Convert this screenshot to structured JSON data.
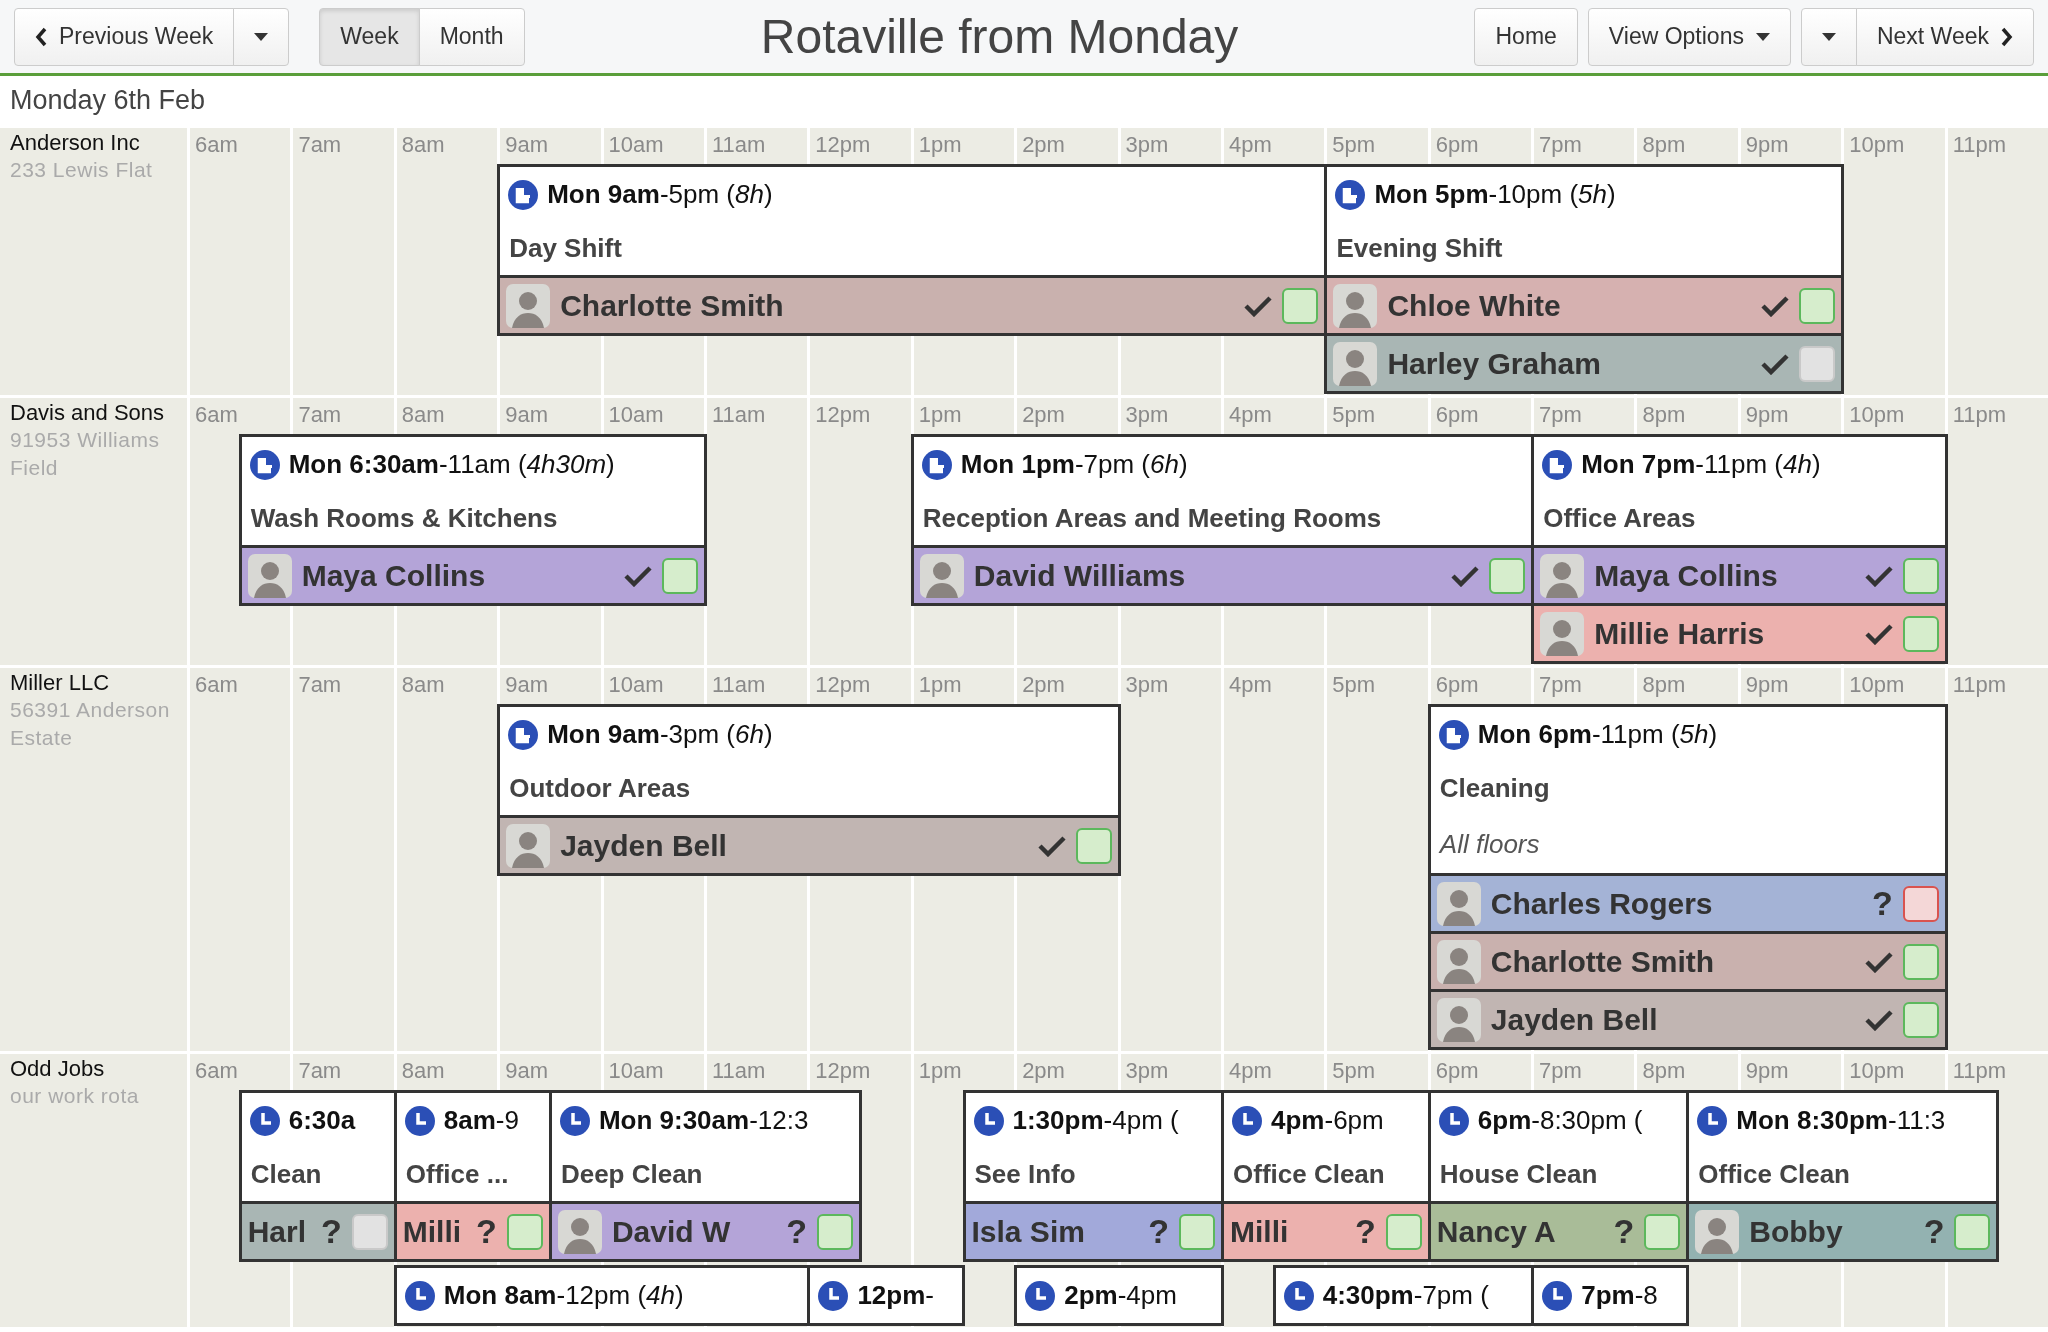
{
  "header": {
    "prev_button": "Previous Week",
    "views": [
      {
        "label": "Week",
        "selected": true
      },
      {
        "label": "Month",
        "selected": false
      }
    ],
    "title": "Rotaville from Monday",
    "home_button": "Home",
    "options_button": "View Options",
    "next_button": "Next Week"
  },
  "date": "Monday 6th Feb",
  "rows": [
    {
      "name": "Anderson Inc",
      "address": "233 Lewis Flat",
      "hours": [
        "6am",
        "7am",
        "8am",
        "9am",
        "10am",
        "11am",
        "12pm",
        "1pm",
        "2pm",
        "3pm",
        "4pm",
        "5pm",
        "6pm",
        "7pm",
        "8pm",
        "9pm",
        "10pm",
        "11pm"
      ],
      "shifts": [
        {
          "recurring": true,
          "time": "**Mon 9am**-5pm (*8h*)",
          "title": "Day Shift",
          "staff": [
            {
              "name": "Charlotte Smith",
              "avatar": true,
              "color": "#c9b1ae",
              "confirmed": true,
              "box": {
                "color": "#d6edcc"
              }
            }
          ]
        },
        {
          "recurring": true,
          "time": "**Mon 5pm**-10pm (*5h*)",
          "title": "Evening Shift",
          "staff": [
            {
              "name": "Chloe White",
              "avatar": true,
              "color": "#d6b1b0",
              "confirmed": true,
              "box": {
                "color": "#d6edcc"
              }
            },
            {
              "name": "Harley Graham",
              "avatar": true,
              "color": "#a9b6b4",
              "confirmed": true,
              "box": {
                "color": "#e2e2e2"
              }
            }
          ]
        }
      ]
    },
    {
      "name": "Davis and Sons",
      "address": "91953 Williams Field",
      "hours": [
        "6am",
        "7am",
        "8am",
        "9am",
        "10am",
        "11am",
        "12pm",
        "1pm",
        "2pm",
        "3pm",
        "4pm",
        "5pm",
        "6pm",
        "7pm",
        "8pm",
        "9pm",
        "10pm",
        "11pm"
      ],
      "shifts": [
        {
          "recurring": true,
          "time": "**Mon 6:30am**-11am (*4h30m*)",
          "title": "Wash Rooms & Kitchens",
          "staff": [
            {
              "name": "Maya Collins",
              "avatar": true,
              "color": "#b4a4d8",
              "confirmed": true,
              "box": {
                "color": "#d6edcc"
              }
            }
          ]
        },
        {
          "recurring": true,
          "time": "**Mon 1pm**-7pm (*6h*)",
          "title": "Reception Areas and Meeting Rooms",
          "staff": [
            {
              "name": "David Williams",
              "avatar": true,
              "color": "#b4a4d8",
              "confirmed": true,
              "box": {
                "color": "#d6edcc"
              }
            }
          ]
        },
        {
          "recurring": true,
          "time": "**Mon 7pm**-11pm (*4h*)",
          "title": "Office Areas",
          "staff": [
            {
              "name": "Maya Collins",
              "avatar": true,
              "color": "#b4a4d8",
              "confirmed": true,
              "box": {
                "color": "#d6edcc"
              }
            },
            {
              "name": "Millie Harris",
              "avatar": true,
              "color": "#ecb1ae",
              "confirmed": true,
              "box": {
                "color": "#d6edcc"
              }
            }
          ]
        }
      ]
    },
    {
      "name": "Miller LLC",
      "address": "56391 Anderson Estate",
      "hours": [
        "6am",
        "7am",
        "8am",
        "9am",
        "10am",
        "11am",
        "12pm",
        "1pm",
        "2pm",
        "3pm",
        "4pm",
        "5pm",
        "6pm",
        "7pm",
        "8pm",
        "9pm",
        "10pm",
        "11pm"
      ],
      "shifts": [
        {
          "recurring": true,
          "time": "**Mon 9am**-3pm (*6h*)",
          "title": "Outdoor Areas",
          "staff": [
            {
              "name": "Jayden Bell",
              "avatar": true,
              "color": "#c1b5b2",
              "confirmed": true,
              "box": {
                "color": "#d6edcc"
              }
            }
          ]
        },
        {
          "recurring": true,
          "time": "**Mon 6pm**-11pm (*5h*)",
          "title": "Cleaning",
          "note": "All floors",
          "staff": [
            {
              "name": "Charles Rogers",
              "avatar": true,
              "color": "#a4b3d6",
              "confirmed": false,
              "answer": "?",
              "box": {
                "color": "#f4d7d7"
              }
            },
            {
              "name": "Charlotte Smith",
              "avatar": true,
              "color": "#c9b1ae",
              "confirmed": true,
              "box": {
                "color": "#d6edcc"
              }
            },
            {
              "name": "Jayden Bell",
              "avatar": true,
              "color": "#c1b5b2",
              "confirmed": true,
              "box": {
                "color": "#d6edcc"
              }
            }
          ]
        }
      ]
    },
    {
      "name": "Odd Jobs",
      "address": "our work rota",
      "hours": [
        "6am",
        "7am",
        "8am",
        "9am",
        "10am",
        "11am",
        "12pm",
        "1pm",
        "2pm",
        "3pm",
        "4pm",
        "5pm",
        "6pm",
        "7pm",
        "8pm",
        "9pm",
        "10pm",
        "11pm"
      ],
      "shifts": [
        {
          "recurring": false,
          "time": "**6:30a**",
          "title": "Clean",
          "staff": [
            {
              "name": "Harl",
              "avatar": false,
              "color": "#a9b6b4",
              "confirmed": false,
              "answer": "?",
              "box": {
                "color": "#e2e2e2"
              }
            }
          ]
        },
        {
          "recurring": false,
          "time": "**8am**-9",
          "title": "Office ...",
          "staff": [
            {
              "name": "Milli",
              "avatar": false,
              "color": "#ecb1ae",
              "confirmed": false,
              "answer": "?",
              "box": {
                "color": "#d6edcc"
              }
            }
          ]
        },
        {
          "recurring": false,
          "time": "**Mon 9:30am**-12:3",
          "title": "Deep Clean",
          "staff": [
            {
              "name": "David W",
              "avatar": true,
              "color": "#b4a4d8",
              "confirmed": false,
              "answer": "?",
              "box": {
                "color": "#d6edcc"
              }
            }
          ]
        },
        {
          "recurring": false,
          "time": "**1:30pm**-4pm (",
          "title": "See Info",
          "staff": [
            {
              "name": "Isla Sim",
              "avatar": false,
              "color": "#a2a9da",
              "confirmed": false,
              "answer": "?",
              "box": {
                "color": "#d6edcc"
              }
            }
          ]
        },
        {
          "recurring": false,
          "time": "**4pm**-6pm",
          "title": "Office Clean",
          "staff": [
            {
              "name": "Milli",
              "avatar": false,
              "color": "#ecb1ae",
              "confirmed": false,
              "answer": "?",
              "box": {
                "color": "#d6edcc"
              }
            }
          ]
        },
        {
          "recurring": false,
          "time": "**6pm**-8:30pm (",
          "title": "House Clean",
          "staff": [
            {
              "name": "Nancy A",
              "avatar": false,
              "color": "#a9bc98",
              "confirmed": false,
              "answer": "?",
              "box": {
                "color": "#d6edcc"
              }
            }
          ]
        },
        {
          "recurring": false,
          "time": "**Mon 8:30pm**-11:3",
          "title": "Office Clean",
          "staff": [
            {
              "name": "Bobby",
              "avatar": true,
              "color": "#93b2b1",
              "confirmed": false,
              "answer": "?",
              "box": {
                "color": "#d6edcc"
              }
            }
          ]
        },
        {
          "recurring": false,
          "time": "**Mon 8am**-12pm (*4h*)"
        },
        {
          "recurring": false,
          "time": "**12pm**-"
        },
        {
          "recurring": false,
          "time": "**2pm**-4pm"
        },
        {
          "recurring": false,
          "time": "**4:30pm**-7pm ("
        },
        {
          "recurring": false,
          "time": "**7pm**-8"
        }
      ]
    }
  ]
}
